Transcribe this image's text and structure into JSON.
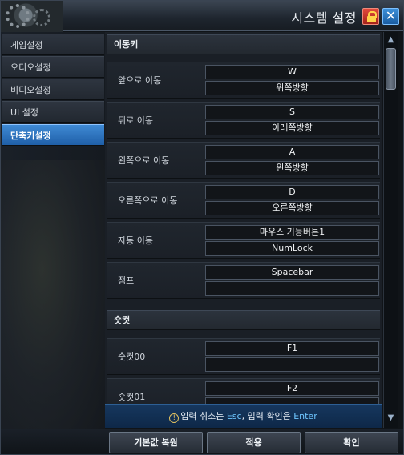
{
  "window": {
    "title": "시스템 설정"
  },
  "nav": {
    "items": [
      "게임설정",
      "오디오설정",
      "비디오설정",
      "UI 설정",
      "단축키설정"
    ],
    "active_index": 4
  },
  "content": {
    "sections": [
      {
        "title": "이동키",
        "rows": [
          {
            "label": "앞으로 이동",
            "key1": "W",
            "key2": "위쪽방향"
          },
          {
            "label": "뒤로 이동",
            "key1": "S",
            "key2": "아래쪽방향"
          },
          {
            "label": "왼쪽으로 이동",
            "key1": "A",
            "key2": "왼쪽방향"
          },
          {
            "label": "오른쪽으로 이동",
            "key1": "D",
            "key2": "오른쪽방향"
          },
          {
            "label": "자동 이동",
            "key1": "마우스 기능버튼1",
            "key2": "NumLock"
          },
          {
            "label": "점프",
            "key1": "Spacebar",
            "key2": ""
          }
        ]
      },
      {
        "title": "숏컷",
        "rows": [
          {
            "label": "숏컷00",
            "key1": "F1",
            "key2": ""
          },
          {
            "label": "숏컷01",
            "key1": "F2",
            "key2": ""
          }
        ]
      }
    ]
  },
  "hint": {
    "icon": "info-icon",
    "text_before": "입력 취소는 ",
    "esc": "Esc",
    "text_mid": ", 입력 확인은 ",
    "enter": "Enter"
  },
  "buttons": {
    "reset": "기본값 복원",
    "apply": "적용",
    "ok": "확인"
  },
  "colors": {
    "active_tab": "#2f74c0",
    "hint_accent": "#6ec6ff",
    "lock_button": "#c0392b",
    "close_button": "#2a78c8"
  },
  "scrollbar": {
    "position_fraction": 0.0
  }
}
